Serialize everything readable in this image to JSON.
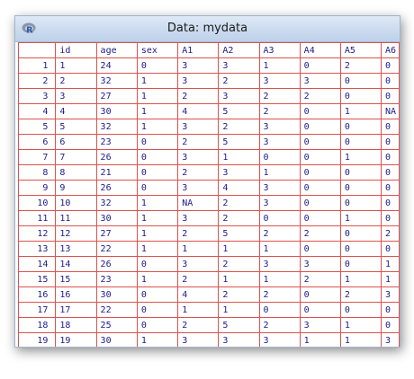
{
  "window": {
    "title": "Data: mydata",
    "icon": "r-logo-icon"
  },
  "table": {
    "columns": [
      "id",
      "age",
      "sex",
      "A1",
      "A2",
      "A3",
      "A4",
      "A5",
      "A6"
    ],
    "rows": [
      {
        "num": "1",
        "cells": [
          "1",
          "24",
          "0",
          "3",
          "3",
          "1",
          "0",
          "2",
          "0"
        ]
      },
      {
        "num": "2",
        "cells": [
          "2",
          "32",
          "1",
          "3",
          "2",
          "3",
          "3",
          "0",
          "0"
        ]
      },
      {
        "num": "3",
        "cells": [
          "3",
          "27",
          "1",
          "2",
          "3",
          "2",
          "2",
          "0",
          "0"
        ]
      },
      {
        "num": "4",
        "cells": [
          "4",
          "30",
          "1",
          "4",
          "5",
          "2",
          "0",
          "1",
          "NA"
        ]
      },
      {
        "num": "5",
        "cells": [
          "5",
          "32",
          "1",
          "3",
          "2",
          "3",
          "0",
          "0",
          "0"
        ]
      },
      {
        "num": "6",
        "cells": [
          "6",
          "23",
          "0",
          "2",
          "5",
          "3",
          "0",
          "0",
          "0"
        ]
      },
      {
        "num": "7",
        "cells": [
          "7",
          "26",
          "0",
          "3",
          "1",
          "0",
          "0",
          "1",
          "0"
        ]
      },
      {
        "num": "8",
        "cells": [
          "8",
          "21",
          "0",
          "2",
          "3",
          "1",
          "0",
          "0",
          "0"
        ]
      },
      {
        "num": "9",
        "cells": [
          "9",
          "26",
          "0",
          "3",
          "4",
          "3",
          "0",
          "0",
          "0"
        ]
      },
      {
        "num": "10",
        "cells": [
          "10",
          "32",
          "1",
          "NA",
          "2",
          "3",
          "0",
          "0",
          "0"
        ]
      },
      {
        "num": "11",
        "cells": [
          "11",
          "30",
          "1",
          "3",
          "2",
          "0",
          "0",
          "1",
          "0"
        ]
      },
      {
        "num": "12",
        "cells": [
          "12",
          "27",
          "1",
          "2",
          "5",
          "2",
          "2",
          "0",
          "2"
        ]
      },
      {
        "num": "13",
        "cells": [
          "13",
          "22",
          "1",
          "1",
          "1",
          "1",
          "0",
          "0",
          "0"
        ]
      },
      {
        "num": "14",
        "cells": [
          "14",
          "26",
          "0",
          "3",
          "2",
          "3",
          "3",
          "0",
          "1"
        ]
      },
      {
        "num": "15",
        "cells": [
          "15",
          "23",
          "1",
          "2",
          "1",
          "1",
          "2",
          "1",
          "1"
        ]
      },
      {
        "num": "16",
        "cells": [
          "16",
          "30",
          "0",
          "4",
          "2",
          "2",
          "0",
          "2",
          "3"
        ]
      },
      {
        "num": "17",
        "cells": [
          "17",
          "22",
          "0",
          "1",
          "1",
          "0",
          "0",
          "0",
          "0"
        ]
      },
      {
        "num": "18",
        "cells": [
          "18",
          "25",
          "0",
          "2",
          "5",
          "2",
          "3",
          "1",
          "0"
        ]
      },
      {
        "num": "19",
        "cells": [
          "19",
          "30",
          "1",
          "3",
          "3",
          "3",
          "1",
          "1",
          "3"
        ]
      }
    ]
  }
}
